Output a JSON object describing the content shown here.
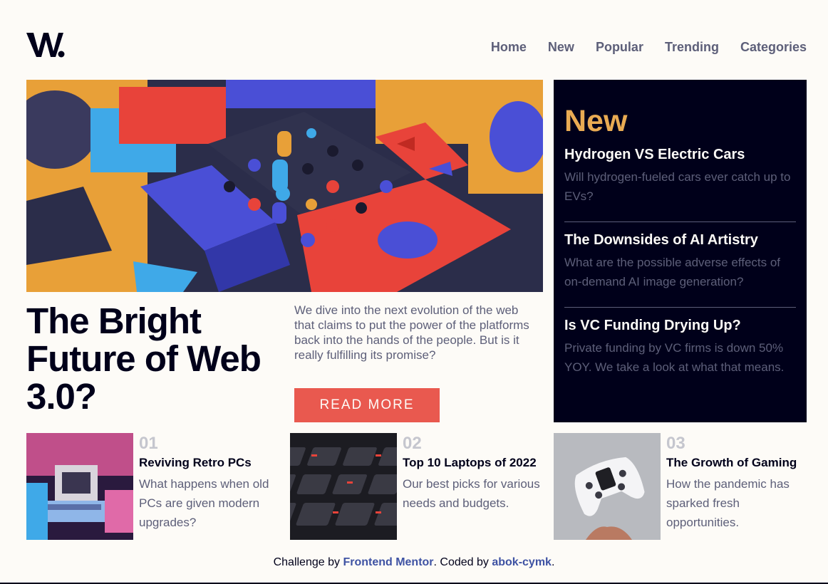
{
  "logo": {
    "text": "W."
  },
  "nav": [
    "Home",
    "New",
    "Popular",
    "Trending",
    "Categories"
  ],
  "hero": {
    "title": "The Bright Future of Web 3.0?",
    "description": "We dive into the next evolution of the web that claims to put the power of the platforms back into the hands of the people. But is it really fulfilling its promise?",
    "button": "READ MORE"
  },
  "new": {
    "heading": "New",
    "items": [
      {
        "title": "Hydrogen VS Electric Cars",
        "text": "Will hydrogen-fueled cars ever catch up to EVs?"
      },
      {
        "title": "The Downsides of AI Artistry",
        "text": "What are the possible adverse effects of on-demand AI image generation?"
      },
      {
        "title": "Is VC Funding Drying Up?",
        "text": "Private funding by VC firms is down 50% YOY. We take a look at what that means."
      }
    ]
  },
  "cards": [
    {
      "num": "01",
      "title": "Reviving Retro PCs",
      "text": "What happens when old PCs are given modern upgrades?"
    },
    {
      "num": "02",
      "title": "Top 10 Laptops of 2022",
      "text": "Our best picks for various needs and budgets."
    },
    {
      "num": "03",
      "title": "The Growth of Gaming",
      "text": "How the pandemic has sparked fresh opportunities."
    }
  ],
  "footer": {
    "prefix": "Challenge by ",
    "link1": "Frontend Mentor",
    "middle": ". Coded by ",
    "link2": "abok-cymk",
    "suffix": "."
  },
  "colors": {
    "accent": "#e9594f",
    "new_heading": "#e9ab53",
    "dark": "#00001a",
    "grey": "#5d5f79",
    "link": "#3e52a3"
  }
}
